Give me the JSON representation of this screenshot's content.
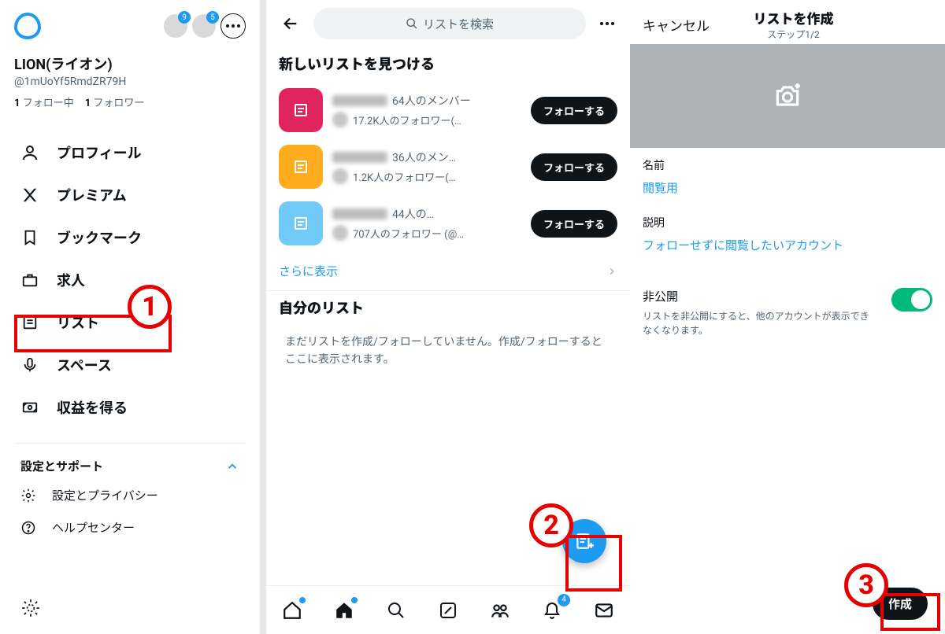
{
  "left": {
    "badges": {
      "a": "9",
      "b": "5"
    },
    "profile_name": "LION(ライオン)",
    "profile_handle": "@1mUoYf5RmdZR79H",
    "following_count": "1",
    "following_label": "フォロー中",
    "followers_count": "1",
    "followers_label": "フォロワー",
    "nav": {
      "profile": "プロフィール",
      "premium": "プレミアム",
      "bookmarks": "ブックマーク",
      "jobs": "求人",
      "lists": "リスト",
      "spaces": "スペース",
      "monetize": "収益を得る"
    },
    "settings_header": "設定とサポート",
    "sub_settings": "設定とプライバシー",
    "sub_help": "ヘルプセンター"
  },
  "mid": {
    "search_placeholder": "リストを検索",
    "discover_title": "新しいリストを見つける",
    "lists": [
      {
        "color": "#e0245e",
        "members": "64人のメンバー",
        "followers": "17.2K人のフォロワー(…"
      },
      {
        "color": "#ffad1f",
        "members": "36人のメン…",
        "followers": "1.2K人のフォロワー(…"
      },
      {
        "color": "#71c9f8",
        "members": "44人の…",
        "followers": "707人のフォロワー (@…"
      }
    ],
    "follow_label": "フォローする",
    "show_more": "さらに表示",
    "own_lists_title": "自分のリスト",
    "own_lists_empty": "まだリストを作成/フォローしていません。作成/フォローするとここに表示されます。",
    "tab_badge": "4"
  },
  "right": {
    "cancel": "キャンセル",
    "title": "リストを作成",
    "step": "ステップ1/2",
    "name_label": "名前",
    "name_value": "閲覧用",
    "desc_label": "説明",
    "desc_value": "フォローせずに閲覧したいアカウント",
    "private_label": "非公開",
    "private_desc": "リストを非公開にすると、他のアカウントが表示できなくなります。",
    "create_btn": "作成"
  },
  "annotations": {
    "n1": "1",
    "n2": "2",
    "n3": "3"
  }
}
